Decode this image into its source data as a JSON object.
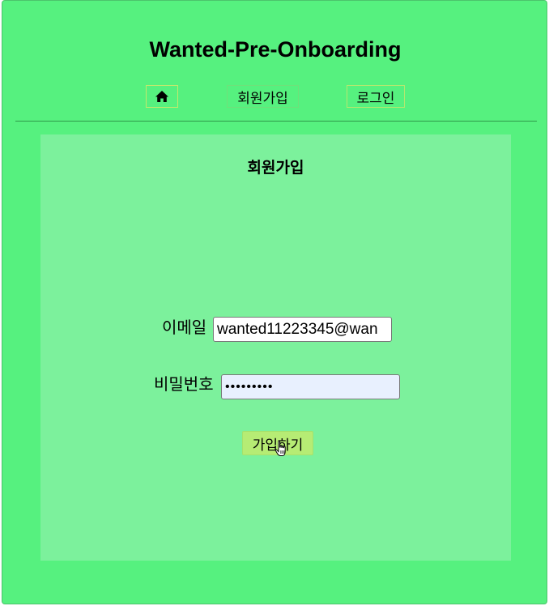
{
  "header": {
    "title": "Wanted-Pre-Onboarding"
  },
  "nav": {
    "home_icon": "home-icon",
    "signup_label": "회원가입",
    "login_label": "로그인"
  },
  "form": {
    "title": "회원가입",
    "email_label": "이메일",
    "email_value": "wanted11223345@wan",
    "password_label": "비밀번호",
    "password_value": "•••••••••",
    "submit_label": "가입하기"
  },
  "colors": {
    "app_background": "#56f17f",
    "panel_background": "#7cf19c",
    "submit_button": "#b6ec74",
    "password_autofill": "#e8f0fe"
  }
}
